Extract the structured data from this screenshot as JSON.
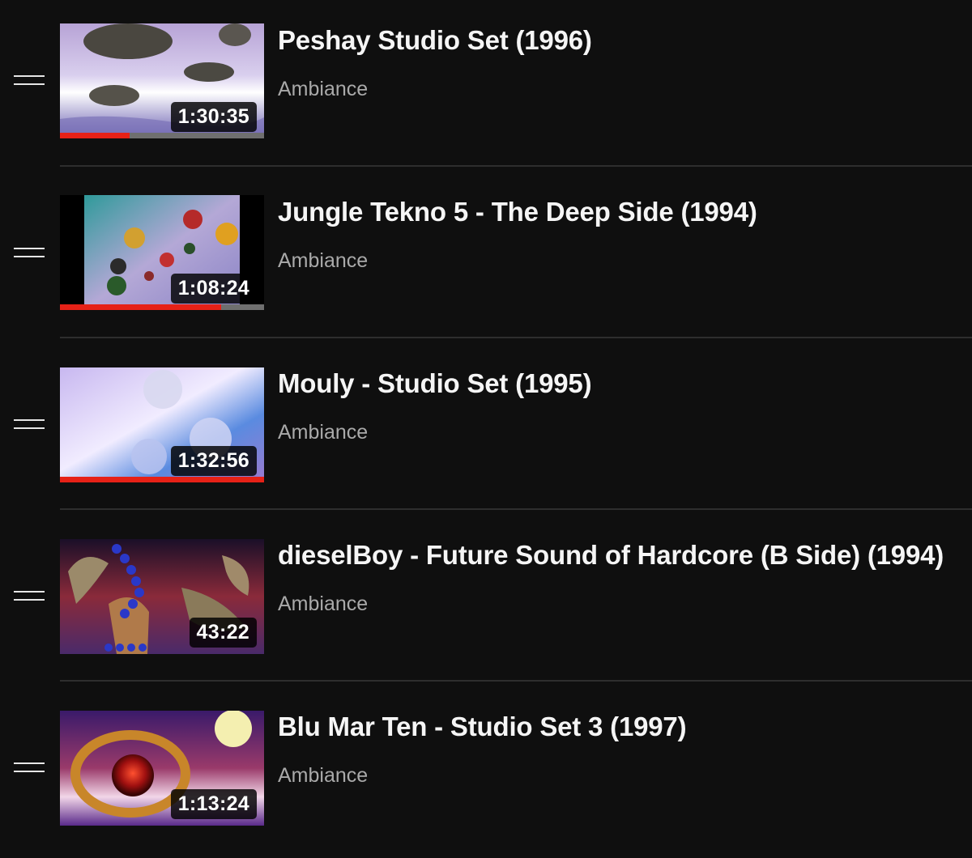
{
  "playlist": {
    "items": [
      {
        "title": "Peshay Studio Set (1996)",
        "channel": "Ambiance",
        "duration": "1:30:35",
        "watched_fraction": 0.34
      },
      {
        "title": "Jungle Tekno 5 - The Deep Side (1994)",
        "channel": "Ambiance",
        "duration": "1:08:24",
        "watched_fraction": 0.79
      },
      {
        "title": "Mouly - Studio Set (1995)",
        "channel": "Ambiance",
        "duration": "1:32:56",
        "watched_fraction": 1.0
      },
      {
        "title": "dieselBoy - Future Sound of Hardcore (B Side) (1994)",
        "channel": "Ambiance",
        "duration": "43:22",
        "watched_fraction": 0
      },
      {
        "title": "Blu Mar Ten - Studio Set 3 (1997)",
        "channel": "Ambiance",
        "duration": "1:13:24",
        "watched_fraction": 0
      }
    ]
  },
  "colors": {
    "background": "#0f0f0f",
    "progress_fill": "#e62117",
    "progress_track": "#6f6f6f",
    "secondary_text": "#a9a9a9"
  },
  "icons": {
    "drag_handle": "drag-handle-icon"
  }
}
